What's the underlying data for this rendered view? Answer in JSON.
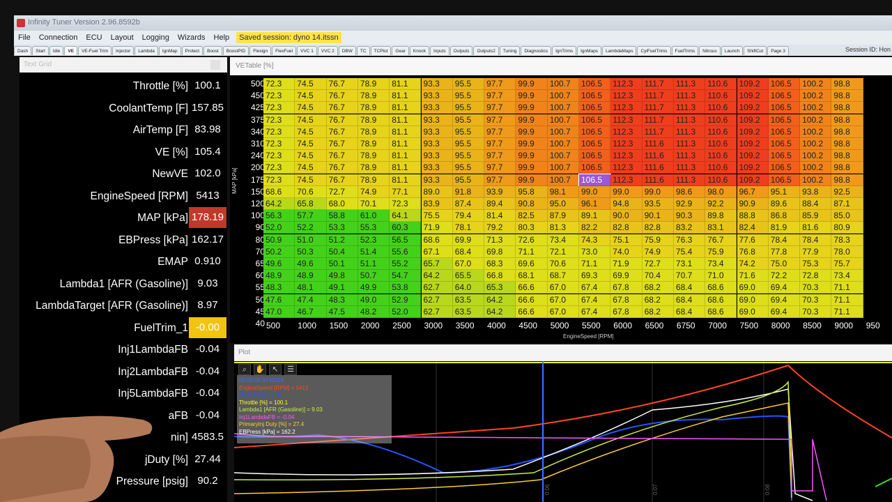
{
  "window": {
    "title": "Infinity Tuner Version 2.96.8592b"
  },
  "menu": {
    "items": [
      "File",
      "Connection",
      "ECU",
      "Layout",
      "Logging",
      "Wizards",
      "Help"
    ],
    "session_badge": "Saved session: dyno 14.itssn"
  },
  "tabs": [
    "Dash",
    "Start",
    "Idle",
    "VE",
    "VE-Fuel Trim",
    "Injector",
    "Lambda",
    "IgnMap",
    "Protect",
    "Boost",
    "BoostPID",
    "Flexign",
    "FlexFuel",
    "VVC 1",
    "VVC 2",
    "DBW",
    "TC",
    "TCPlot",
    "Gear",
    "Knock",
    "Inputs",
    "Outputs",
    "Outputs2",
    "Tuning",
    "Diagnostics",
    "IgnTrims",
    "IgnMaps",
    "LambdaMaps",
    "CylFuelTrims",
    "FuelTrims",
    "Nitrous",
    "Launch",
    "ShiftCut",
    "Page 3"
  ],
  "active_tab": "VE",
  "session_id": "Session ID: Hon",
  "text_grid": {
    "header": "Text Grid",
    "rows": [
      {
        "label": "Throttle [%]",
        "value": "100.1",
        "style": ""
      },
      {
        "label": "CoolantTemp [F]",
        "value": "157.85",
        "style": ""
      },
      {
        "label": "AirTemp [F]",
        "value": "83.98",
        "style": ""
      },
      {
        "label": "VE [%]",
        "value": "105.4",
        "style": ""
      },
      {
        "label": "NewVE",
        "value": "102.0",
        "style": ""
      },
      {
        "label": "EngineSpeed [RPM]",
        "value": "5413",
        "style": ""
      },
      {
        "label": "MAP [kPa]",
        "value": "178.19",
        "style": "red"
      },
      {
        "label": "EBPress [kPa]",
        "value": "162.17",
        "style": ""
      },
      {
        "label": "EMAP",
        "value": "0.910",
        "style": ""
      },
      {
        "label": "Lambda1 [AFR (Gasoline)]",
        "value": "9.03",
        "style": ""
      },
      {
        "label": "LambdaTarget [AFR (Gasoline)]",
        "value": "8.97",
        "style": ""
      },
      {
        "label": "FuelTrim_1",
        "value": "-0.00",
        "style": "yellow"
      },
      {
        "label": "Inj1LambdaFB",
        "value": "-0.04",
        "style": ""
      },
      {
        "label": "Inj2LambdaFB",
        "value": "-0.04",
        "style": ""
      },
      {
        "label": "Inj5LambdaFB",
        "value": "-0.04",
        "style": ""
      },
      {
        "label": "aFB",
        "value": "-0.04",
        "style": ""
      },
      {
        "label": "nin]",
        "value": "4583.5",
        "style": ""
      },
      {
        "label": "jDuty [%]",
        "value": "27.44",
        "style": ""
      },
      {
        "label": "Pressure [psig]",
        "value": "90.2",
        "style": ""
      }
    ]
  },
  "ve_table": {
    "header": "VETable [%]",
    "y_axis_title": "MAP [kPa]",
    "x_axis_title": "EngineSpeed [RPM]",
    "map_labels": [
      "500",
      "450",
      "425",
      "375",
      "340",
      "310",
      "240",
      "200",
      "175",
      "150",
      "120",
      "100",
      "90",
      "80",
      "70",
      "65",
      "60",
      "55",
      "50",
      "45",
      "40"
    ],
    "rpm_labels": [
      "500",
      "1000",
      "1500",
      "2000",
      "2500",
      "3000",
      "3500",
      "4000",
      "4500",
      "5000",
      "5500",
      "6000",
      "6500",
      "6750",
      "7000",
      "7500",
      "8000",
      "8500",
      "9000",
      "950"
    ],
    "rows": [
      [
        "72.3",
        "74.5",
        "76.7",
        "78.9",
        "81.1",
        "93.3",
        "95.5",
        "97.7",
        "99.9",
        "100.7",
        "106.5",
        "112.3",
        "111.7",
        "111.3",
        "110.6",
        "109.2",
        "106.5",
        "100.2",
        "98.8"
      ],
      [
        "72.3",
        "74.5",
        "76.7",
        "78.9",
        "81.1",
        "93.3",
        "95.5",
        "97.7",
        "99.9",
        "100.7",
        "106.5",
        "112.3",
        "111.7",
        "111.3",
        "110.6",
        "109.2",
        "106.5",
        "100.2",
        "98.8"
      ],
      [
        "72.3",
        "74.5",
        "76.7",
        "78.9",
        "81.1",
        "93.3",
        "95.5",
        "97.7",
        "99.9",
        "100.7",
        "106.5",
        "112.3",
        "111.7",
        "111.3",
        "110.6",
        "109.2",
        "106.5",
        "100.2",
        "98.8"
      ],
      [
        "72.3",
        "74.5",
        "76.7",
        "78.9",
        "81.1",
        "93.3",
        "95.5",
        "97.7",
        "99.9",
        "100.7",
        "106.5",
        "112.3",
        "111.7",
        "111.3",
        "110.6",
        "109.2",
        "106.5",
        "100.2",
        "98.8"
      ],
      [
        "72.3",
        "74.5",
        "76.7",
        "78.9",
        "81.1",
        "93.3",
        "95.5",
        "97.7",
        "99.9",
        "100.7",
        "106.5",
        "112.3",
        "111.7",
        "111.3",
        "110.6",
        "109.2",
        "106.5",
        "100.2",
        "98.8"
      ],
      [
        "72.3",
        "74.5",
        "76.7",
        "78.9",
        "81.1",
        "93.3",
        "95.5",
        "97.7",
        "99.9",
        "100.7",
        "106.5",
        "112.3",
        "111.6",
        "111.3",
        "110.6",
        "109.2",
        "106.5",
        "100.2",
        "98.8"
      ],
      [
        "72.3",
        "74.5",
        "76.7",
        "78.9",
        "81.1",
        "93.3",
        "95.5",
        "97.7",
        "99.9",
        "100.7",
        "106.5",
        "112.3",
        "111.6",
        "111.3",
        "110.6",
        "109.2",
        "106.5",
        "100.2",
        "98.8"
      ],
      [
        "72.3",
        "74.5",
        "76.7",
        "78.9",
        "81.1",
        "93.3",
        "95.5",
        "97.7",
        "99.9",
        "100.7",
        "106.5",
        "112.3",
        "111.6",
        "111.3",
        "110.6",
        "109.2",
        "106.5",
        "100.2",
        "98.8"
      ],
      [
        "72.3",
        "74.5",
        "76.7",
        "78.9",
        "81.1",
        "93.3",
        "95.5",
        "97.7",
        "99.9",
        "100.7",
        "106.5",
        "112.3",
        "111.6",
        "111.3",
        "110.6",
        "109.2",
        "106.5",
        "100.2",
        "98.8"
      ],
      [
        "68.6",
        "70.6",
        "72.7",
        "74.9",
        "77.1",
        "89.0",
        "91.8",
        "93.9",
        "95.8",
        "98.1",
        "99.0",
        "99.0",
        "99.0",
        "98.6",
        "98.0",
        "96.7",
        "95.1",
        "93.8",
        "92.5"
      ],
      [
        "64.2",
        "65.8",
        "68.0",
        "70.1",
        "72.3",
        "83.9",
        "87.4",
        "89.4",
        "90.8",
        "95.0",
        "96.1",
        "94.8",
        "93.5",
        "92.9",
        "92.2",
        "90.9",
        "89.6",
        "88.4",
        "87.1"
      ],
      [
        "56.3",
        "57.7",
        "58.8",
        "61.0",
        "64.1",
        "75.5",
        "79.4",
        "81.4",
        "82.5",
        "87.9",
        "89.1",
        "90.0",
        "90.1",
        "90.3",
        "89.8",
        "88.8",
        "86.8",
        "85.9",
        "85.0"
      ],
      [
        "52.0",
        "52.2",
        "53.3",
        "55.3",
        "60.3",
        "71.9",
        "78.1",
        "79.2",
        "80.3",
        "81.3",
        "82.2",
        "82.8",
        "82.8",
        "83.2",
        "83.1",
        "82.4",
        "81.9",
        "81.6",
        "80.9"
      ],
      [
        "50.9",
        "51.0",
        "51.2",
        "52.3",
        "56.5",
        "68.6",
        "69.9",
        "71.3",
        "72.6",
        "73.4",
        "74.3",
        "75.1",
        "75.9",
        "76.3",
        "76.7",
        "77.6",
        "78.4",
        "78.4",
        "78.3"
      ],
      [
        "50.2",
        "50.3",
        "50.4",
        "51.4",
        "55.6",
        "67.1",
        "68.4",
        "69.8",
        "71.1",
        "72.1",
        "73.0",
        "74.0",
        "74.9",
        "75.4",
        "75.9",
        "76.8",
        "77.8",
        "77.9",
        "78.0"
      ],
      [
        "49.6",
        "49.6",
        "50.1",
        "51.1",
        "55.2",
        "65.7",
        "67.0",
        "68.3",
        "69.6",
        "70.6",
        "71.1",
        "71.9",
        "72.7",
        "73.1",
        "73.4",
        "74.2",
        "75.0",
        "75.3",
        "75.7"
      ],
      [
        "48.9",
        "48.9",
        "49.8",
        "50.7",
        "54.7",
        "64.2",
        "65.5",
        "66.8",
        "68.1",
        "68.7",
        "69.3",
        "69.9",
        "70.4",
        "70.7",
        "71.0",
        "71.6",
        "72.2",
        "72.8",
        "73.4"
      ],
      [
        "48.3",
        "48.1",
        "49.1",
        "49.9",
        "53.8",
        "62.7",
        "64.0",
        "65.3",
        "66.6",
        "67.0",
        "67.4",
        "67.8",
        "68.2",
        "68.4",
        "68.6",
        "69.0",
        "69.4",
        "70.3",
        "71.1"
      ],
      [
        "47.6",
        "47.4",
        "48.3",
        "49.0",
        "52.9",
        "62.7",
        "63.5",
        "64.2",
        "66.6",
        "67.0",
        "67.4",
        "67.8",
        "68.2",
        "68.4",
        "68.6",
        "69.0",
        "69.4",
        "70.3",
        "71.1"
      ],
      [
        "47.0",
        "46.7",
        "47.5",
        "48.2",
        "52.0",
        "62.7",
        "63.5",
        "64.2",
        "66.6",
        "67.0",
        "67.4",
        "67.8",
        "68.2",
        "68.4",
        "68.6",
        "69.0",
        "69.4",
        "70.3",
        "71.1"
      ]
    ],
    "selected_cell": {
      "row": 8,
      "col": 10
    }
  },
  "plot": {
    "header": "Plot",
    "legend": [
      {
        "text": "00:00:05.9742119",
        "color": "#3a6cff"
      },
      {
        "text": "EngineSpeed [RPM] = 5413",
        "color": "#ff4422"
      },
      {
        "text": "MAP [kPa] = 178",
        "color": "#2255ff"
      },
      {
        "text": "Throttle [%] = 100.1",
        "color": "#ffff33"
      },
      {
        "text": "Lambda1 [AFR (Gasoline)] = 9.03",
        "color": "#ccee44"
      },
      {
        "text": "Inj1LambdaFB = -0.04",
        "color": "#ff55ff"
      },
      {
        "text": "PrimaryInj Duty [%] = 27.4",
        "color": "#ffcc33"
      },
      {
        "text": "EBPress [kPa] = 162.2",
        "color": "#ffffff"
      }
    ],
    "toolbar_icons": [
      "magnifier-icon",
      "hand-icon",
      "pointer-icon",
      "list-icon"
    ],
    "time_labels": [
      "0:06",
      "0:07",
      "0:08"
    ]
  }
}
